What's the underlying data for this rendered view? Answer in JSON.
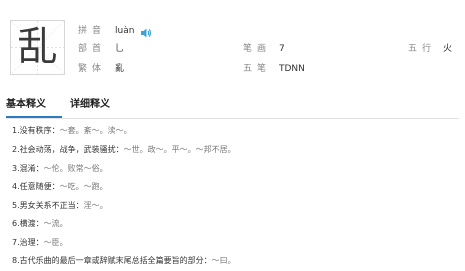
{
  "character": "乱",
  "info": {
    "pinyin": {
      "label": "拼音",
      "value": "luàn"
    },
    "radical": {
      "label": "部首",
      "value": "乚"
    },
    "traditional": {
      "label": "繁体",
      "value": "亂"
    },
    "strokes": {
      "label": "笔画",
      "value": "7"
    },
    "wubi": {
      "label": "五笔",
      "value": "TDNN"
    },
    "wuxing": {
      "label": "五行",
      "value": "火"
    }
  },
  "tabs": {
    "basic": "基本释义",
    "detail": "详细释义"
  },
  "definitions": [
    {
      "num": "1.",
      "text": "没有秩序：",
      "example": "～套。紊～。渎～。"
    },
    {
      "num": "2.",
      "text": "社会动荡，战争，武装骚扰：",
      "example": "～世。政～。平～。～邦不居。"
    },
    {
      "num": "3.",
      "text": "混淆：",
      "example": "～伦。败常～俗。"
    },
    {
      "num": "4.",
      "text": "任意随便：",
      "example": "～吃。～跑。"
    },
    {
      "num": "5.",
      "text": "男女关系不正当：",
      "example": "淫～。"
    },
    {
      "num": "6.",
      "text": "横渡：",
      "example": "～流。"
    },
    {
      "num": "7.",
      "text": "治理：",
      "example": "～臣。"
    },
    {
      "num": "8.",
      "text": "古代乐曲的最后一章或辞赋末尾总括全篇要旨的部分：",
      "example": "～曰。"
    }
  ],
  "colors": {
    "accent": "#2b7bc4",
    "speaker": "#3aa4d8"
  },
  "icons": {
    "speaker": "speaker-icon"
  }
}
